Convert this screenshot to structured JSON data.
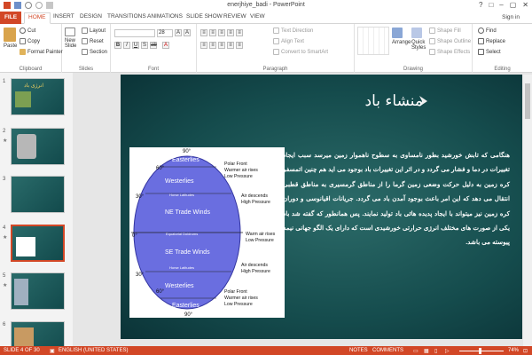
{
  "window": {
    "title": "enerjhiye_badi - PowerPoint",
    "controls": [
      "?",
      "□",
      "–",
      "▢",
      "✕"
    ]
  },
  "tabs": [
    "FILE",
    "HOME",
    "INSERT",
    "DESIGN",
    "TRANSITIONS",
    "ANIMATIONS",
    "SLIDE SHOW",
    "REVIEW",
    "VIEW"
  ],
  "signin": "Sign in",
  "ribbon": {
    "clipboard": {
      "label": "Clipboard",
      "paste": "Paste",
      "cut": "Cut",
      "copy": "Copy",
      "format_painter": "Format Painter"
    },
    "slides": {
      "label": "Slides",
      "new_slide": "New Slide",
      "layout": "Layout",
      "reset": "Reset",
      "section": "Section"
    },
    "font": {
      "label": "Font",
      "size": "28"
    },
    "paragraph": {
      "label": "Paragraph",
      "text_direction": "Text Direction",
      "align_text": "Align Text",
      "convert": "Convert to SmartArt"
    },
    "drawing": {
      "label": "Drawing",
      "arrange": "Arrange",
      "quick_styles": "Quick Styles",
      "shape_fill": "Shape Fill",
      "shape_outline": "Shape Outline",
      "shape_effects": "Shape Effects"
    },
    "editing": {
      "label": "Editing",
      "find": "Find",
      "replace": "Replace",
      "select": "Select"
    }
  },
  "thumbnails": {
    "numbers": [
      "1",
      "2",
      "3",
      "4",
      "5",
      "6"
    ],
    "star": "★",
    "slide1_title": "انرژی باد"
  },
  "slide": {
    "title": "منشاء باد",
    "body": "هنگامی که تابش خورشید بطور نامساوی به سطوح ناهموار زمین میرسد سبب ایجاد تغییرات در دما و فشار می گردد و در اثر این تغییرات باد بوجود می اید هم چنین اتمسفر کره زمین به دلیل حرکت وضعی زمین گرما را از مناطق گرمسیری به مناطق قطبی انتقال می دهد که این امر باعث بوجود آمدن باد می گردد. جریانات اقیانوسی و دوران کره زمین نیز میتواند با ایجاد پدیده هائی باد تولید نمایند. پس همانطور که گفته شد باد یکی از صورت های مختلف انرژی حرارتی خورشیدی است که دارای یک الگو جهانی نیمه پیوسته می باشد.",
    "diagram": {
      "degrees": [
        "90°",
        "60°",
        "30°",
        "0°",
        "30°",
        "60°",
        "90°"
      ],
      "bands": [
        "Easterlies",
        "Westerlies",
        "Horse Latitudes",
        "NE Trade Winds",
        "Equatorial Doldrums",
        "SE Trade Winds",
        "Horse Latitudes",
        "Westerlies",
        "Easterlies"
      ],
      "annotations": [
        {
          "title": "Polar Front",
          "lines": [
            "Warmer air rises",
            "Low Pressure"
          ]
        },
        {
          "title": "Air descends",
          "lines": [
            "High Pressure"
          ]
        },
        {
          "title": "Warm air rises",
          "lines": [
            "Low Pressure"
          ]
        },
        {
          "title": "Air descends",
          "lines": [
            "High Pressure"
          ]
        },
        {
          "title": "Polar Front",
          "lines": [
            "Warmer air rises",
            "Low Pressure"
          ]
        }
      ]
    }
  },
  "status": {
    "slide": "SLIDE 4 OF 30",
    "language": "ENGLISH (UNITED STATES)",
    "notes": "NOTES",
    "comments": "COMMENTS",
    "zoom": "74%"
  },
  "colors": {
    "accent": "#d24726",
    "slide_bg": "#1b5556",
    "globe": "#6a6ee0"
  }
}
